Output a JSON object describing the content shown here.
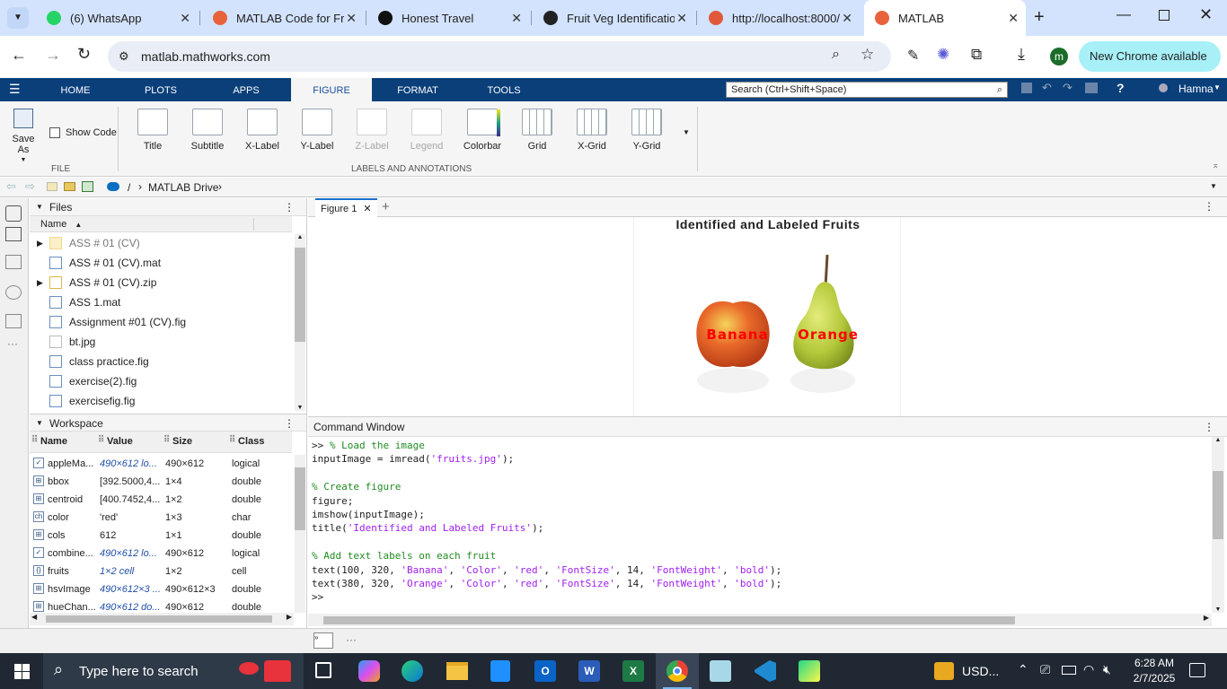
{
  "browser": {
    "tabs": [
      {
        "title": "(6) WhatsApp",
        "color": "#25d366"
      },
      {
        "title": "MATLAB Code for Fru",
        "color": "#e8633c"
      },
      {
        "title": "Honest Travel",
        "color": "#111111"
      },
      {
        "title": "Fruit Veg Identificatio",
        "color": "#222222"
      },
      {
        "title": "http://localhost:8000/",
        "color": "#e05a3a"
      },
      {
        "title": "MATLAB",
        "color": "#e8633c"
      }
    ],
    "url": "matlab.mathworks.com",
    "profile_initial": "m",
    "update_label": "New Chrome available"
  },
  "toolstrip": {
    "tabs": [
      "HOME",
      "PLOTS",
      "APPS",
      "FIGURE",
      "FORMAT",
      "TOOLS"
    ],
    "active_tab": "FIGURE",
    "search_placeholder": "Search (Ctrl+Shift+Space)",
    "user": "Hamna",
    "file_group": {
      "save_as": "Save As",
      "show_code": "Show Code",
      "label": "FILE"
    },
    "annotations": [
      "Title",
      "Subtitle",
      "X-Label",
      "Y-Label",
      "Z-Label",
      "Legend",
      "Colorbar",
      "Grid",
      "X-Grid",
      "Y-Grid"
    ],
    "annotations_label": "LABELS AND ANNOTATIONS"
  },
  "address": {
    "root": "/",
    "drive": "MATLAB Drive"
  },
  "files": {
    "title": "Files",
    "column": "Name",
    "items": [
      {
        "name": "ASS # 01 (CV)",
        "kind": "folder"
      },
      {
        "name": "ASS # 01 (CV).mat",
        "kind": "mat"
      },
      {
        "name": "ASS # 01 (CV).zip",
        "kind": "zip"
      },
      {
        "name": "ASS 1.mat",
        "kind": "mat"
      },
      {
        "name": "Assignment #01 (CV).fig",
        "kind": "fig"
      },
      {
        "name": "bt.jpg",
        "kind": "jpg"
      },
      {
        "name": "class practice.fig",
        "kind": "fig"
      },
      {
        "name": "exercise(2).fig",
        "kind": "fig"
      },
      {
        "name": "exercisefig.fig",
        "kind": "fig"
      }
    ]
  },
  "workspace": {
    "title": "Workspace",
    "columns": [
      "Name",
      "Value",
      "Size",
      "Class"
    ],
    "rows": [
      {
        "name": "appleMa...",
        "value": "490×612 lo...",
        "size": "490×612",
        "cls": "logical"
      },
      {
        "name": "bbox",
        "value": "[392.5000,4...",
        "size": "1×4",
        "cls": "double"
      },
      {
        "name": "centroid",
        "value": "[400.7452,4...",
        "size": "1×2",
        "cls": "double"
      },
      {
        "name": "color",
        "value": "'red'",
        "size": "1×3",
        "cls": "char"
      },
      {
        "name": "cols",
        "value": "612",
        "size": "1×1",
        "cls": "double"
      },
      {
        "name": "combine...",
        "value": "490×612 lo...",
        "size": "490×612",
        "cls": "logical"
      },
      {
        "name": "fruits",
        "value": "1×2 cell",
        "size": "1×2",
        "cls": "cell"
      },
      {
        "name": "hsvImage",
        "value": "490×612×3 ...",
        "size": "490×612×3",
        "cls": "double"
      },
      {
        "name": "hueChan...",
        "value": "490×612 do...",
        "size": "490×612",
        "cls": "double"
      }
    ]
  },
  "figure": {
    "tab": "Figure 1",
    "title": "Identified and Labeled Fruits",
    "label1": "Banana",
    "label2": "Orange"
  },
  "command_window": {
    "title": "Command Window",
    "prompt": ">>",
    "lines": [
      {
        "t": "c",
        "s": "% Load the image",
        "p": ">> "
      },
      {
        "t": "x",
        "s": "inputImage = imread(",
        "str": "'fruits.jpg'",
        "end": ");"
      },
      {
        "t": "b"
      },
      {
        "t": "c",
        "s": "% Create figure"
      },
      {
        "t": "x",
        "s": "figure;"
      },
      {
        "t": "x",
        "s": "imshow(inputImage);"
      },
      {
        "t": "x",
        "s": "title(",
        "str": "'Identified and Labeled Fruits'",
        "end": ");"
      },
      {
        "t": "b"
      },
      {
        "t": "c",
        "s": "% Add text labels on each fruit"
      },
      {
        "t": "m",
        "s": "text(100, 320, ",
        "parts": [
          "'Banana'",
          ", ",
          "'Color'",
          ", ",
          "'red'",
          ", ",
          "'FontSize'",
          ", 14, ",
          "'FontWeight'",
          ", ",
          "'bold'",
          ");"
        ]
      },
      {
        "t": "m",
        "s": "text(380, 320, ",
        "parts": [
          "'Orange'",
          ", ",
          "'Color'",
          ", ",
          "'red'",
          ", ",
          "'FontSize'",
          ", 14, ",
          "'FontWeight'",
          ", ",
          "'bold'",
          ");"
        ]
      },
      {
        "t": "x",
        "s": ">>"
      }
    ]
  },
  "taskbar": {
    "search_placeholder": "Type here to search",
    "weather": "USD...",
    "time": "6:28 AM",
    "date": "2/7/2025"
  }
}
